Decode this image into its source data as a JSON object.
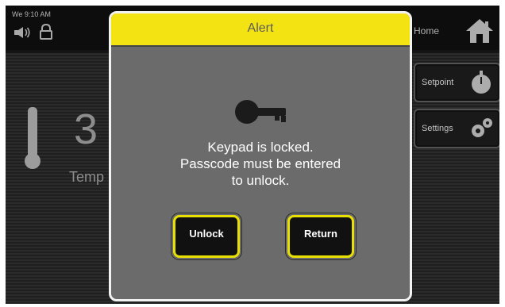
{
  "status_bar": {
    "datetime": "We 9:10 AM",
    "icons": [
      "speaker-icon",
      "lock-icon"
    ],
    "home_label": "Home",
    "home_icon": "home-icon"
  },
  "main": {
    "temperature_partial": "3",
    "temperature_label_partial": "Temp",
    "thermometer_icon": "thermometer-icon",
    "side_buttons": [
      {
        "label": "Setpoint",
        "icon": "setpoint-icon"
      },
      {
        "label": "Settings",
        "icon": "gear-icon"
      }
    ]
  },
  "dialog": {
    "title": "Alert",
    "icon": "key-icon",
    "message_lines": [
      "Keypad is locked.",
      "Passcode must be entered",
      "to unlock."
    ],
    "buttons": {
      "unlock": "Unlock",
      "return": "Return"
    }
  },
  "colors": {
    "header_yellow": "#f4e313",
    "button_border_yellow": "#e8e000",
    "dialog_gray": "#6b6b6b",
    "screen_dark": "#1b1b1b"
  }
}
